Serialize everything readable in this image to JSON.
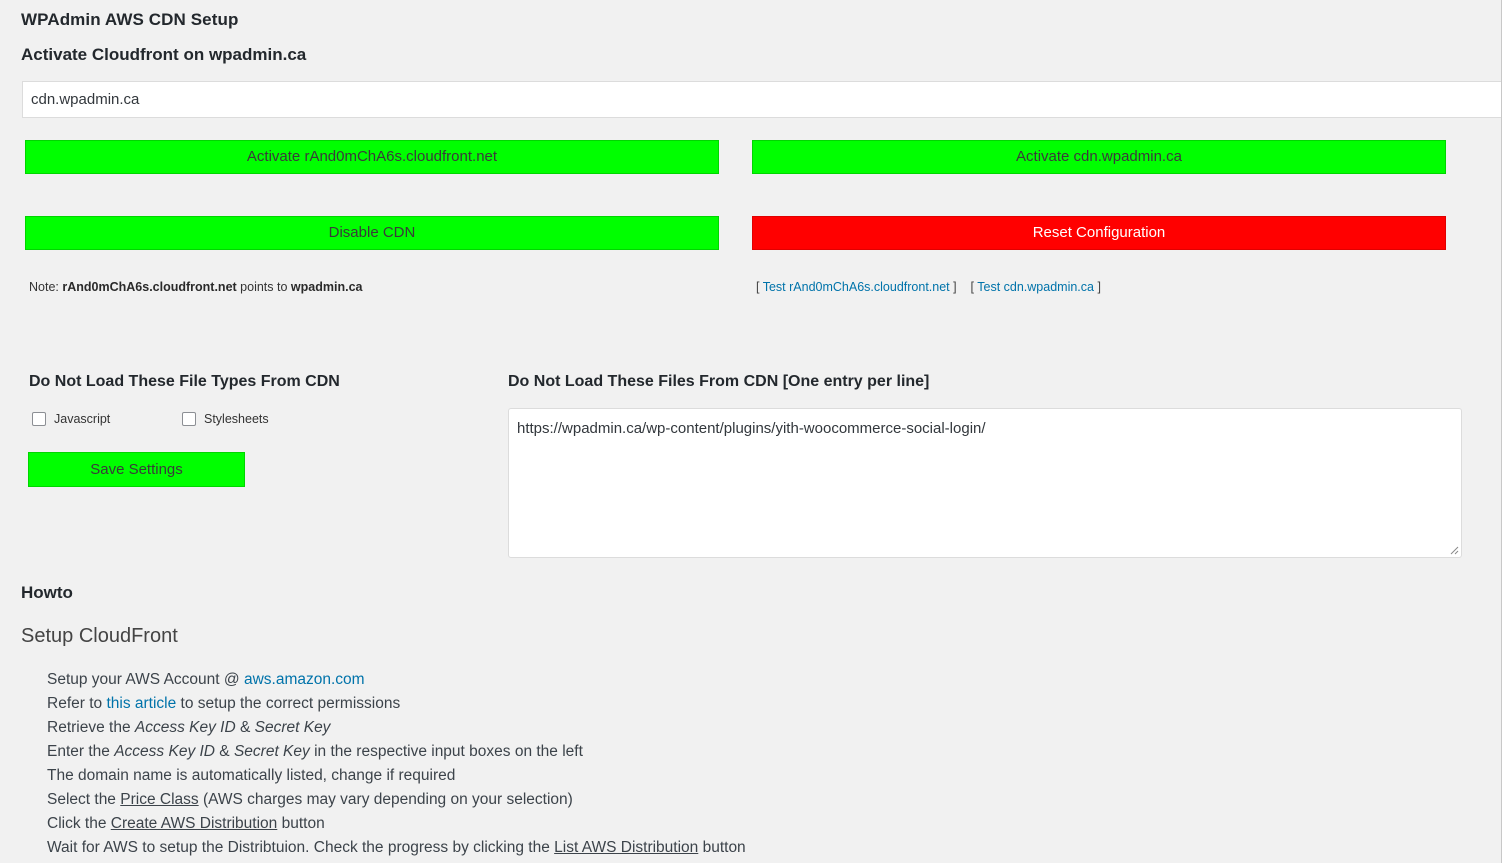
{
  "header": {
    "title": "WPAdmin AWS CDN Setup",
    "subtitle": "Activate Cloudfront on wpadmin.ca"
  },
  "domain_input": {
    "value": "cdn.wpadmin.ca"
  },
  "buttons": {
    "activate_cloudfront": "Activate rAnd0mChA6s.cloudfront.net",
    "activate_cdn": "Activate cdn.wpadmin.ca",
    "disable_cdn": "Disable CDN",
    "reset_configuration": "Reset Configuration",
    "save_settings": "Save Settings"
  },
  "note": {
    "prefix": "Note:",
    "cloudfront_host": "rAnd0mChA6s.cloudfront.net",
    "middle": "points to",
    "target": "wpadmin.ca"
  },
  "tests": {
    "open1": "[",
    "link1": "Test rAnd0mChA6s.cloudfront.net",
    "close1": "]",
    "open2": "[",
    "link2": "Test cdn.wpadmin.ca",
    "close2": "]"
  },
  "file_types": {
    "heading": "Do Not Load These File Types From CDN",
    "javascript_label": "Javascript",
    "stylesheets_label": "Stylesheets",
    "javascript_checked": false,
    "stylesheets_checked": false
  },
  "files": {
    "heading": "Do Not Load These Files From CDN [One entry per line]",
    "value": "https://wpadmin.ca/wp-content/plugins/yith-woocommerce-social-login/"
  },
  "howto": {
    "heading": "Howto",
    "setup_title": "Setup CloudFront",
    "steps": {
      "s1_text": "Setup your AWS Account @ ",
      "s1_link": "aws.amazon.com",
      "s2_pre": "Refer to ",
      "s2_link": "this article",
      "s2_post": " to setup the correct permissions",
      "s3_pre": "Retrieve the ",
      "s3_em1": "Access Key ID",
      "s3_mid": " & ",
      "s3_em2": "Secret Key",
      "s4_pre": "Enter the ",
      "s4_em1": "Access Key ID",
      "s4_mid": " & ",
      "s4_em2": "Secret Key",
      "s4_post": " in the respective input boxes on the left",
      "s5": "The domain name is automatically listed, change if required",
      "s6_pre": "Select the ",
      "s6_u": "Price Class",
      "s6_post": " (AWS charges may vary depending on your selection)",
      "s7_pre": "Click the ",
      "s7_u": "Create AWS Distribution",
      "s7_post": " button",
      "s8_pre": "Wait for AWS to setup the Distribtuion. Check the progress by clicking the ",
      "s8_u": "List AWS Distribution",
      "s8_post": " button"
    }
  },
  "colors": {
    "green_button": "#00ff00",
    "red_button": "#ff0000",
    "link": "#0073aa",
    "background": "#f1f1f1"
  }
}
